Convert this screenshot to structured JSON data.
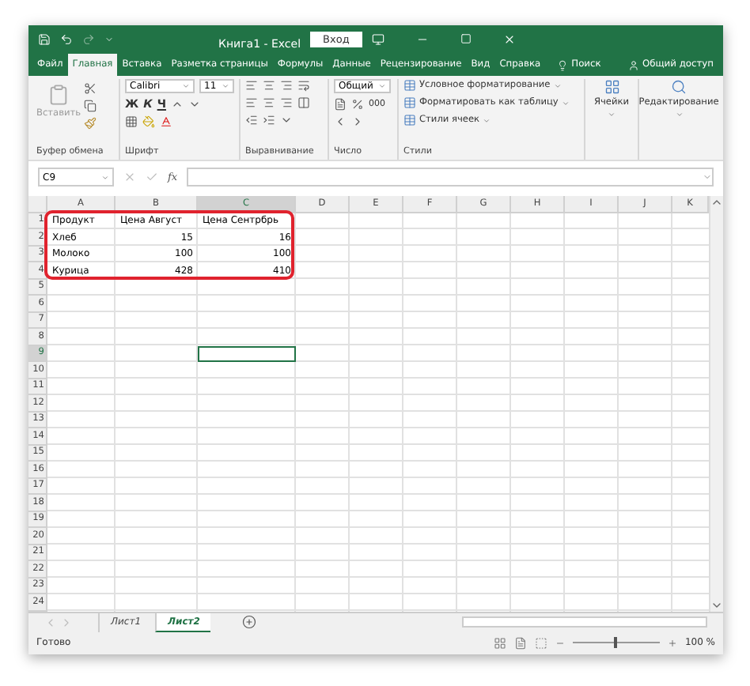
{
  "title_bar": {
    "title": "Книга1 - Excel",
    "sign_in": "Вход"
  },
  "ribbon_tabs": [
    {
      "label": "Файл",
      "selected": false
    },
    {
      "label": "Главная",
      "selected": true
    },
    {
      "label": "Вставка",
      "selected": false
    },
    {
      "label": "Разметка страницы",
      "selected": false
    },
    {
      "label": "Формулы",
      "selected": false
    },
    {
      "label": "Данные",
      "selected": false
    },
    {
      "label": "Рецензирование",
      "selected": false
    },
    {
      "label": "Вид",
      "selected": false
    },
    {
      "label": "Справка",
      "selected": false
    }
  ],
  "search": {
    "label": "Поиск"
  },
  "share": {
    "label": "Общий доступ"
  },
  "ribbon": {
    "clipboard": {
      "label": "Буфер обмена",
      "paste": "Вставить"
    },
    "font": {
      "label": "Шрифт",
      "font_name": "Calibri",
      "font_size": "11",
      "bold": "Ж",
      "italic": "К",
      "underline": "Ч"
    },
    "alignment": {
      "label": "Выравнивание"
    },
    "number": {
      "label": "Число",
      "format": "Общий",
      "thousands": "000"
    },
    "styles": {
      "label": "Стили",
      "items": [
        "Условное форматирование",
        "Форматировать как таблицу",
        "Стили ячеек"
      ]
    },
    "cells": {
      "label": "Ячейки"
    },
    "editing": {
      "label": "Редактирование"
    }
  },
  "formula_bar": {
    "name_box": "C9",
    "function_label": "fx"
  },
  "columns": [
    {
      "label": "A",
      "selected": false
    },
    {
      "label": "B",
      "selected": false
    },
    {
      "label": "C",
      "selected": true
    },
    {
      "label": "D",
      "selected": false
    },
    {
      "label": "E",
      "selected": false
    },
    {
      "label": "F",
      "selected": false
    },
    {
      "label": "G",
      "selected": false
    },
    {
      "label": "H",
      "selected": false
    },
    {
      "label": "I",
      "selected": false
    },
    {
      "label": "J",
      "selected": false
    },
    {
      "label": "K",
      "selected": false
    }
  ],
  "rows": [
    {
      "number": "1",
      "selected": false,
      "cells": [
        {
          "text": "Продукт",
          "kind": "text"
        },
        {
          "text": "Цена Август",
          "kind": "text"
        },
        {
          "text": "Цена Сентрбрь",
          "kind": "text"
        }
      ]
    },
    {
      "number": "2",
      "selected": false,
      "cells": [
        {
          "text": "Хлеб",
          "kind": "text"
        },
        {
          "text": "15",
          "kind": "number"
        },
        {
          "text": "16",
          "kind": "number"
        }
      ]
    },
    {
      "number": "3",
      "selected": false,
      "cells": [
        {
          "text": "Молоко",
          "kind": "text"
        },
        {
          "text": "100",
          "kind": "number"
        },
        {
          "text": "100",
          "kind": "number"
        }
      ]
    },
    {
      "number": "4",
      "selected": false,
      "cells": [
        {
          "text": "Курица",
          "kind": "text"
        },
        {
          "text": "428",
          "kind": "number"
        },
        {
          "text": "410",
          "kind": "number"
        }
      ]
    },
    {
      "number": "5",
      "selected": false
    },
    {
      "number": "6",
      "selected": false
    },
    {
      "number": "7",
      "selected": false
    },
    {
      "number": "8",
      "selected": false
    },
    {
      "number": "9",
      "selected": true
    },
    {
      "number": "10",
      "selected": false
    },
    {
      "number": "11",
      "selected": false
    },
    {
      "number": "12",
      "selected": false
    },
    {
      "number": "13",
      "selected": false
    },
    {
      "number": "14",
      "selected": false
    },
    {
      "number": "15",
      "selected": false
    },
    {
      "number": "16",
      "selected": false
    },
    {
      "number": "17",
      "selected": false
    },
    {
      "number": "18",
      "selected": false
    },
    {
      "number": "19",
      "selected": false
    },
    {
      "number": "20",
      "selected": false
    },
    {
      "number": "21",
      "selected": false
    },
    {
      "number": "22",
      "selected": false
    },
    {
      "number": "23",
      "selected": false
    },
    {
      "number": "24",
      "selected": false
    }
  ],
  "sheet_tabs": [
    {
      "label": "Лист1",
      "selected": false
    },
    {
      "label": "Лист2",
      "selected": true
    }
  ],
  "status_bar": {
    "status": "Готово",
    "zoom": "100 %",
    "level": 0.5
  }
}
